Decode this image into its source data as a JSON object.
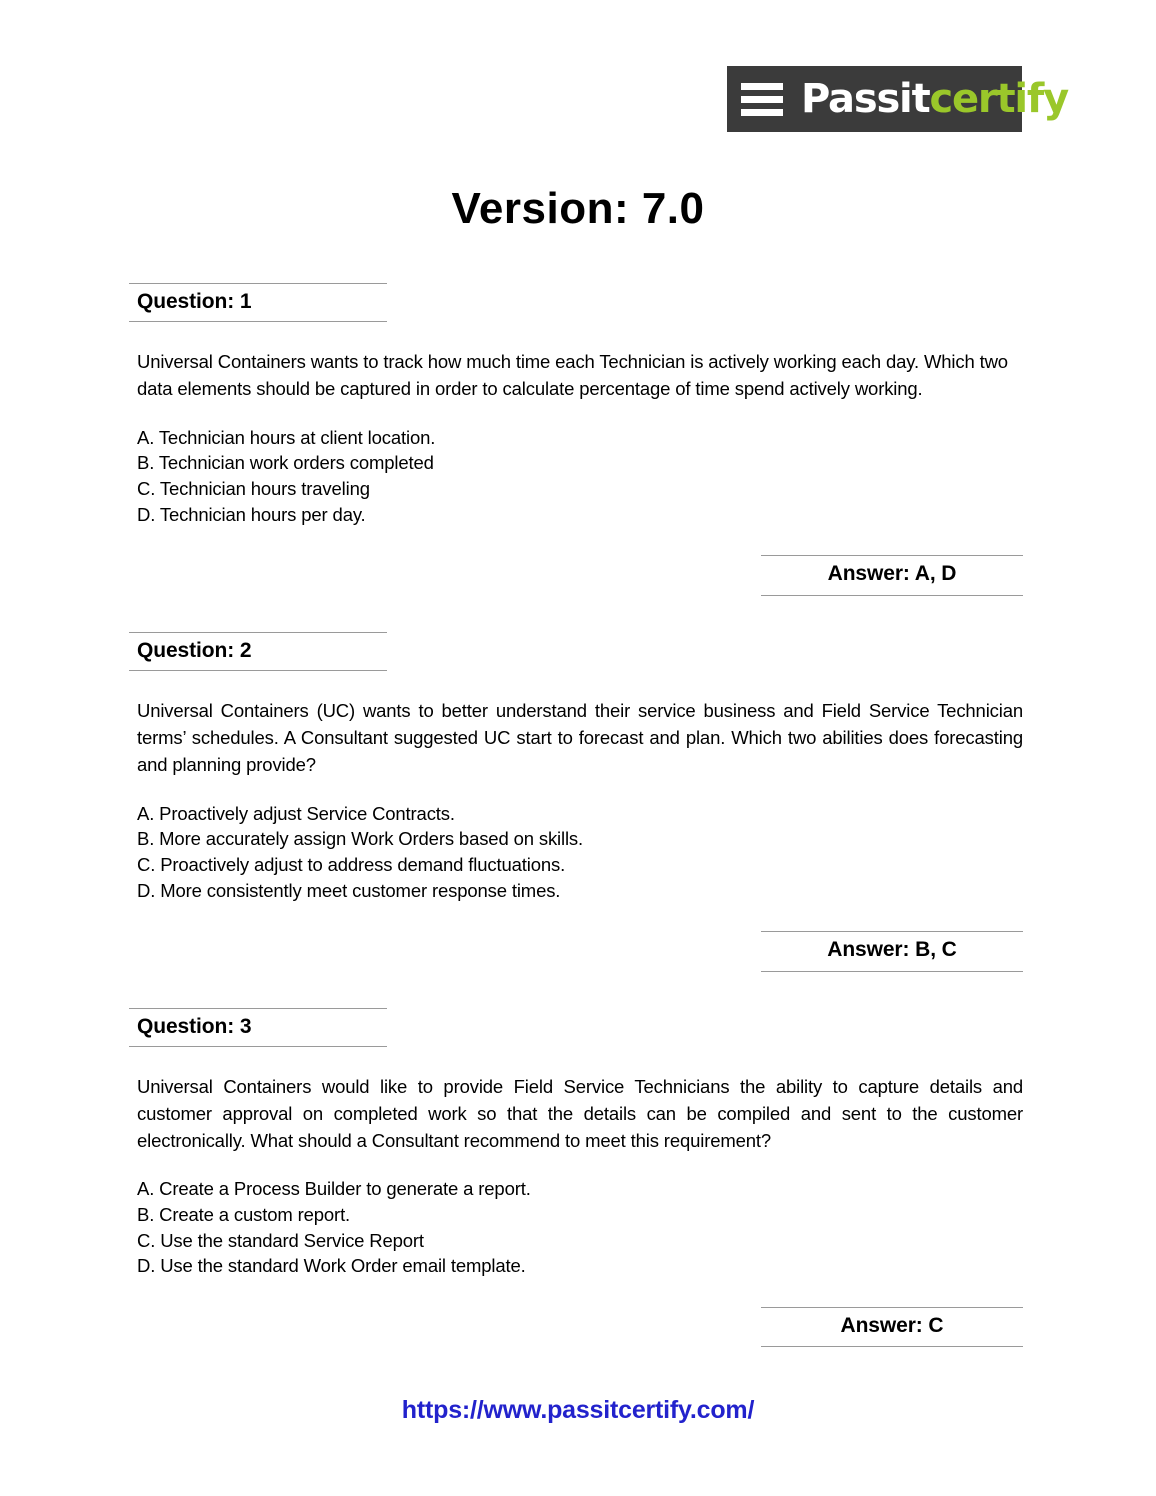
{
  "logo": {
    "name": "passitcertify-logo",
    "hamburger_icon": "hamburger-menu-icon",
    "text_primary": "Passit",
    "text_accent": "certify",
    "background_color": "#3b3b3b",
    "primary_color": "#ffffff",
    "accent_color": "#9ac72a"
  },
  "document": {
    "title": "Version: 7.0"
  },
  "questions": [
    {
      "header": "Question: 1",
      "body": "Universal Containers wants to track how much time each Technician is actively working each day.  Which two data elements should be captured in order to calculate percentage of time spend actively working.",
      "options": [
        "A. Technician hours at client location.",
        "B. Technician work orders completed",
        "C. Technician hours traveling",
        "D. Technician hours per day."
      ],
      "answer": "Answer: A, D"
    },
    {
      "header": "Question: 2",
      "body": "Universal Containers (UC) wants to better understand their service business and Field Service Technician terms’ schedules.  A Consultant suggested UC start to forecast and plan.  Which two abilities does forecasting and planning provide?",
      "options": [
        "A. Proactively adjust Service Contracts.",
        "B. More accurately assign Work Orders based on skills.",
        "C. Proactively adjust to address demand fluctuations.",
        "D. More consistently meet customer response times."
      ],
      "answer": "Answer: B, C"
    },
    {
      "header": "Question: 3",
      "body": "Universal Containers would like to provide Field Service Technicians the ability to capture details and customer approval on completed work so that the details can be compiled and sent to the customer electronically.  What should a Consultant recommend to meet this requirement?",
      "options": [
        "A. Create a Process Builder to generate a report.",
        "B. Create a custom report.",
        "C. Use the standard Service Report",
        "D. Use the standard Work Order email template."
      ],
      "answer": "Answer: C"
    }
  ],
  "footer": {
    "url": "https://www.passitcertify.com/",
    "color": "#2222cc"
  }
}
